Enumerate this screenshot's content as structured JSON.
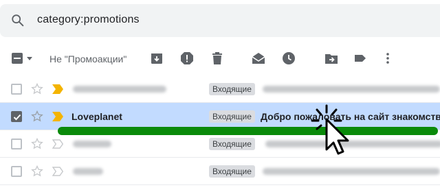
{
  "search": {
    "query": "category:promotions",
    "icon": "search-icon"
  },
  "toolbar": {
    "filter_label": "Не \"Промоакции\"",
    "icons": [
      "select-all-icon",
      "archive-icon",
      "report-spam-icon",
      "delete-icon",
      "mark-read-icon",
      "snooze-icon",
      "move-to-icon",
      "label-icon",
      "more-icon"
    ]
  },
  "rows": [
    {
      "sender": "",
      "label": "Входящие",
      "subject": "",
      "selected": false,
      "important": true
    },
    {
      "sender": "Loveplanet",
      "label": "Входящие",
      "subject": "Добро пожаловать на сайт знакомств",
      "selected": true,
      "important": true
    },
    {
      "sender": "",
      "label": "Входящие",
      "subject": "",
      "selected": false,
      "important": false
    },
    {
      "sender": "",
      "label": "Входящие",
      "subject": "",
      "selected": false,
      "important": false
    }
  ],
  "colors": {
    "selected_row": "#c2dbff",
    "important_marker": "#f4b400",
    "annotation_line": "#0a8a0a"
  }
}
